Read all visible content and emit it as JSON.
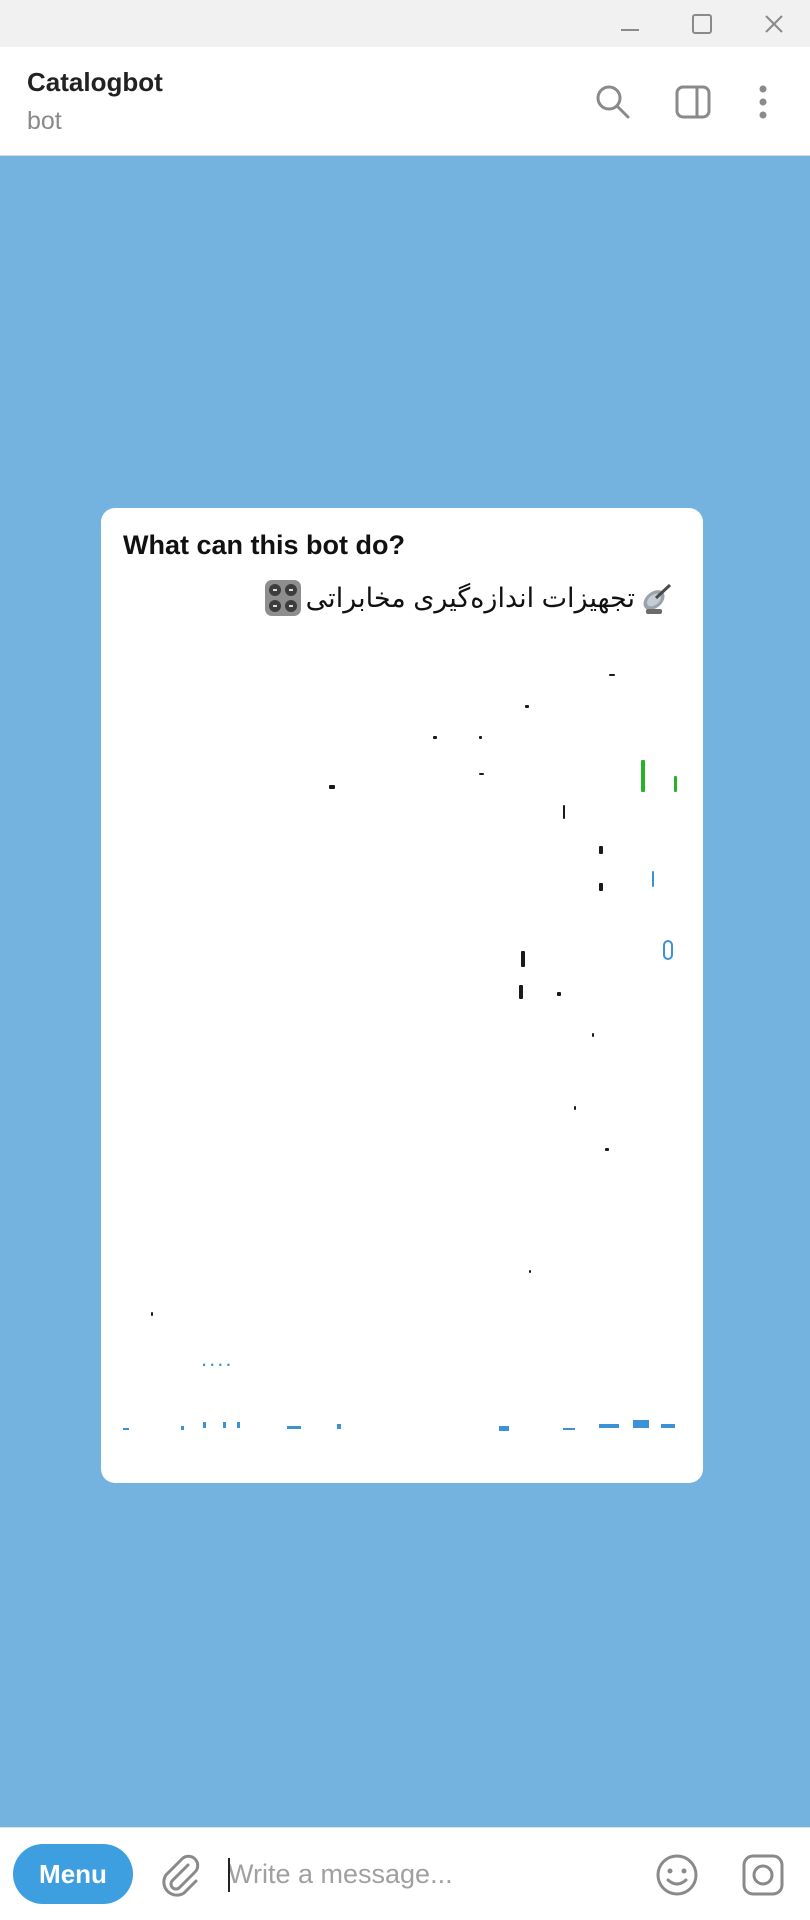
{
  "window": {
    "controls": {
      "minimize_icon": "minimize-icon",
      "maximize_icon": "maximize-icon",
      "close_icon": "close-icon"
    }
  },
  "header": {
    "title": "Catalogbot",
    "subtitle": "bot",
    "icons": [
      "search-icon",
      "sidebar-toggle-icon",
      "more-vertical-icon"
    ]
  },
  "card": {
    "heading": "What can this bot do?",
    "line1_text": "تجهیزات اندازه‌گیری مخابراتی",
    "line1_emojis": [
      "satellite-antenna-icon",
      "control-knobs-icon"
    ],
    "ellipsis": "...."
  },
  "composer": {
    "menu_label": "Menu",
    "placeholder": "Write a message..."
  },
  "colors": {
    "chat_background": "#74b3df",
    "accent": "#3e9fe0",
    "link": "#3b93d6"
  }
}
